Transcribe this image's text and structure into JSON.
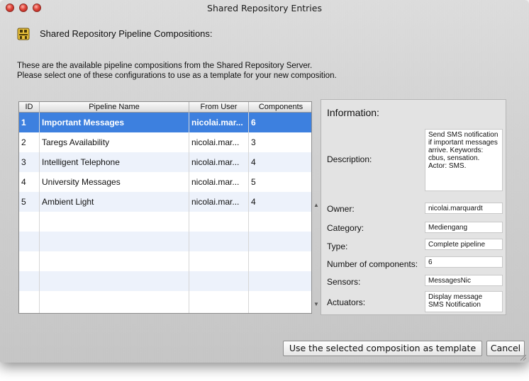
{
  "window": {
    "title": "Shared Repository Entries"
  },
  "header": {
    "icon": "repository-icon",
    "title": "Shared Repository Pipeline Compositions:"
  },
  "intro": {
    "line1": "These are the available pipeline compositions from the Shared Repository Server.",
    "line2": "Please select one of these configurations to use as a template for your new composition."
  },
  "table": {
    "headers": {
      "id": "ID",
      "name": "Pipeline Name",
      "user": "From User",
      "components": "Components"
    },
    "rows": [
      {
        "id": "1",
        "name": "Important Messages",
        "user": "nicolai.mar...",
        "components": "6"
      },
      {
        "id": "2",
        "name": "Taregs Availability",
        "user": "nicolai.mar...",
        "components": "3"
      },
      {
        "id": "3",
        "name": "Intelligent Telephone",
        "user": "nicolai.mar...",
        "components": "4"
      },
      {
        "id": "4",
        "name": "University Messages",
        "user": "nicolai.mar...",
        "components": "5"
      },
      {
        "id": "5",
        "name": "Ambient Light",
        "user": "nicolai.mar...",
        "components": "4"
      }
    ],
    "selected_row": 1
  },
  "info": {
    "title": "Information:",
    "description_label": "Description:",
    "description_value": "Send SMS notification if important messages arrive. Keywords: cbus, sensation. Actor: SMS.",
    "owner_label": "Owner:",
    "owner_value": "nicolai.marquardt",
    "category_label": "Category:",
    "category_value": "Mediengang",
    "type_label": "Type:",
    "type_value": "Complete pipeline",
    "num_components_label": "Number of components:",
    "num_components_value": "6",
    "sensors_label": "Sensors:",
    "sensors_value": "MessagesNic",
    "actuators_label": "Actuators:",
    "actuators_value": "Display message SMS Notification"
  },
  "buttons": {
    "use_template": "Use the selected composition as template",
    "cancel": "Cancel"
  },
  "colors": {
    "selection": "#3d80df",
    "row_alt": "#edf2fb",
    "close_button": "#e0443a"
  }
}
